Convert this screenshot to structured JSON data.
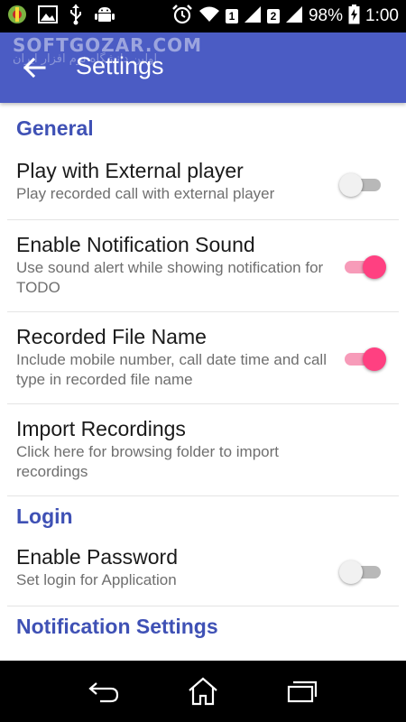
{
  "status_bar": {
    "sim1": "1",
    "sim2": "2",
    "battery": "98%",
    "time": "1:00"
  },
  "watermark": {
    "brand": "SOFTGOZAR.COM",
    "tagline": "اولین دانشگاه نرم افزار ایران"
  },
  "app_bar": {
    "title": "Settings",
    "color": "#4b5cc4"
  },
  "sections": {
    "general": "General",
    "login": "Login",
    "notification": "Notification Settings"
  },
  "prefs": {
    "external_player": {
      "title": "Play with External player",
      "summary": "Play recorded call with external player",
      "enabled": false
    },
    "notification_sound": {
      "title": "Enable Notification Sound",
      "summary": "Use sound alert while showing notification for TODO",
      "enabled": true
    },
    "recorded_file_name": {
      "title": "Recorded File Name",
      "summary": "Include mobile number, call date time and call type in recorded file name",
      "enabled": true
    },
    "import_recordings": {
      "title": "Import Recordings",
      "summary": "Click here for browsing folder to import recordings"
    },
    "enable_password": {
      "title": "Enable Password",
      "summary": "Set login for Application",
      "enabled": false
    }
  },
  "colors": {
    "accent": "#ff4081",
    "category": "#3f51b5"
  },
  "nav_icons": [
    "back-icon",
    "home-icon",
    "recents-icon"
  ]
}
